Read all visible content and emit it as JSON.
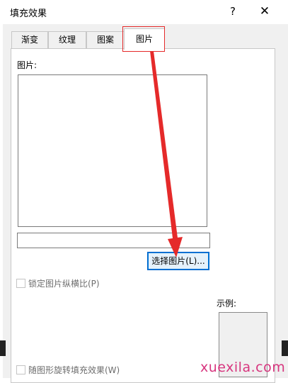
{
  "window": {
    "title": "填充效果",
    "help_label": "?",
    "close_label": "✕"
  },
  "tabs": [
    {
      "label": "渐变",
      "active": false
    },
    {
      "label": "纹理",
      "active": false
    },
    {
      "label": "图案",
      "active": false
    },
    {
      "label": "图片",
      "active": true
    }
  ],
  "picture_section": {
    "label": "图片:",
    "path_value": "",
    "select_button_label": "选择图片(L)..."
  },
  "options": {
    "lock_aspect_label": "锁定图片纵横比(P)",
    "lock_aspect_checked": false,
    "rotate_with_shape_label": "随图形旋转填充效果(W)",
    "rotate_with_shape_checked": false
  },
  "sample": {
    "label": "示例:"
  },
  "annotation": {
    "arrow_color": "#e52a2a",
    "highlight_color": "#e52a2a"
  },
  "watermark": {
    "text": "xuexila.com"
  }
}
